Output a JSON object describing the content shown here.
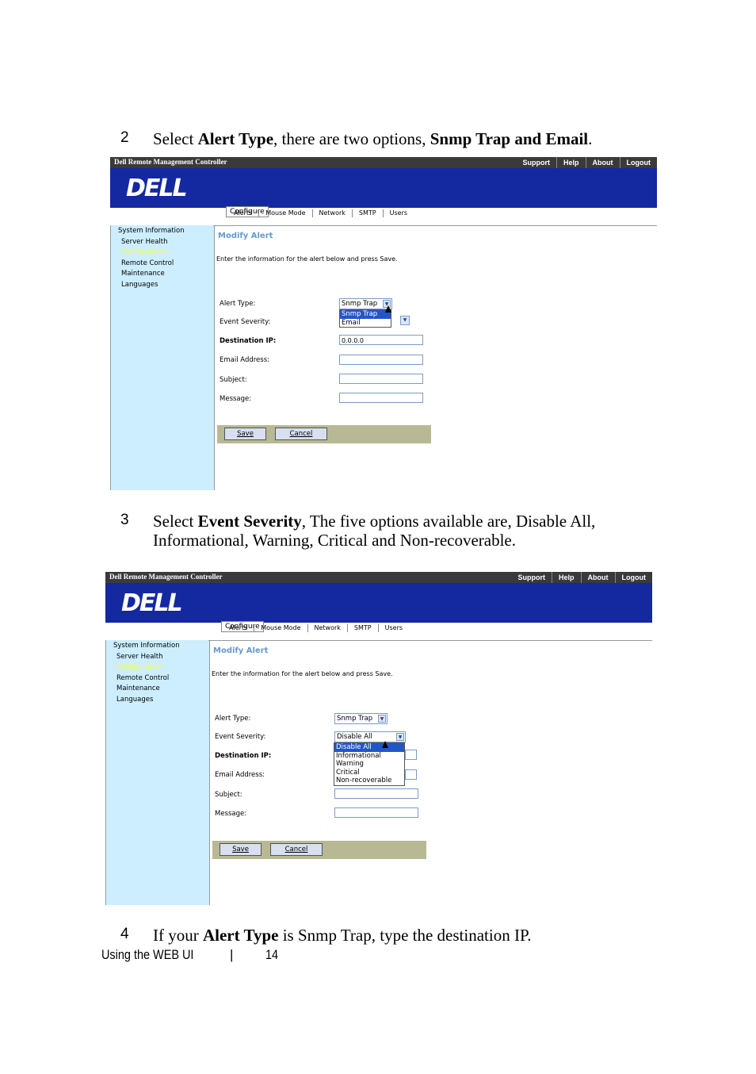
{
  "steps": [
    {
      "num": "2",
      "pre": "Select ",
      "b1": "Alert Type",
      "mid": ", there are two options, ",
      "b2": "Snmp Trap and Email",
      "post": "."
    },
    {
      "num": "3",
      "pre": "Select ",
      "b1": "Event Severity",
      "line1_rest": ", The five options available are, Disable All,",
      "line2": "Informational, Warning, Critical and Non-recoverable."
    },
    {
      "num": "4",
      "pre": "If your ",
      "b1": "Alert Type",
      "post": " is Snmp Trap, type the destination IP."
    }
  ],
  "app": {
    "title": "Dell Remote Management Controller",
    "top_links": [
      "Support",
      "Help",
      "About",
      "Logout"
    ],
    "logo": "DELL",
    "tab": "Configure",
    "subnav": [
      "Alerts",
      "Mouse Mode",
      "Network",
      "SMTP",
      "Users"
    ],
    "sidebar": [
      "System Information",
      "Server Health",
      "Configuration",
      "Remote Control",
      "Maintenance",
      "Languages"
    ],
    "page_title": "Modify Alert",
    "intro": "Enter the information for the alert below and press Save.",
    "labels": {
      "alert_type": "Alert Type:",
      "event_severity": "Event Severity:",
      "destination_ip": "Destination IP:",
      "email_address": "Email Address:",
      "subject": "Subject:",
      "message": "Message:"
    },
    "alert_type_value": "Snmp Trap",
    "alert_type_options": [
      "Snmp Trap",
      "Email"
    ],
    "event_severity_value": "Disable All",
    "event_severity_options": [
      "Disable All",
      "Informational",
      "Warning",
      "Critical",
      "Non-recoverable"
    ],
    "destination_ip_value": "0.0.0.0",
    "save": "Save",
    "cancel": "Cancel",
    "colors": {
      "banner": "#1428a0",
      "sidebar": "#cceeff",
      "title": "#6699cc",
      "selection": "#2256c8"
    }
  },
  "footer": {
    "label": "Using the WEB UI",
    "separator": "|",
    "page": "14"
  }
}
